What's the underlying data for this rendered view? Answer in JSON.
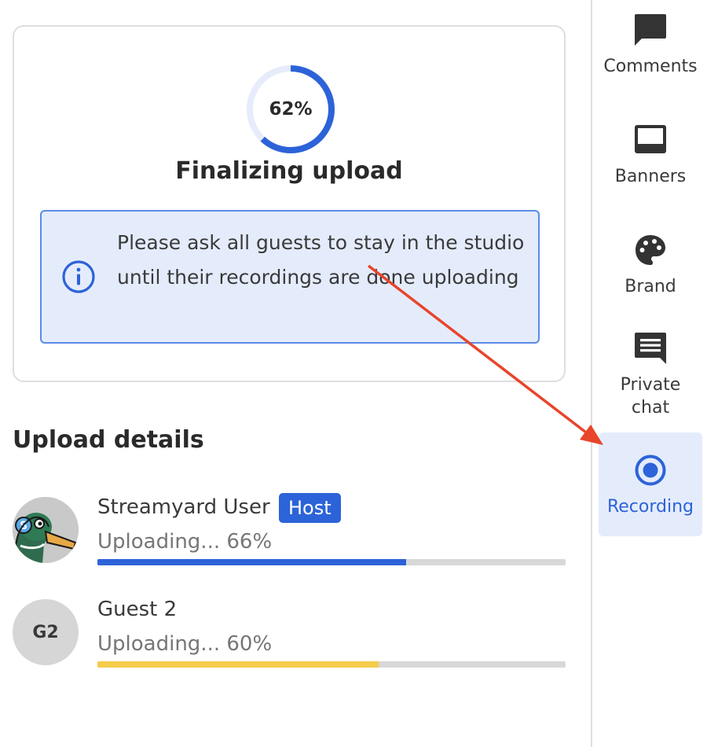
{
  "upload_card": {
    "progress_percent": 62,
    "progress_label": "62%",
    "title": "Finalizing upload",
    "notice_text": "Please ask all guests to stay in the studio until their recordings are done uploading",
    "notice_icon": "info-icon"
  },
  "upload_details": {
    "title": "Upload details",
    "participants": [
      {
        "name": "Streamyard User",
        "badge": "Host",
        "status": "Uploading... 66%",
        "progress_percent": 66,
        "bar_color": "#2d63d8",
        "avatar": "duck-avatar-icon"
      },
      {
        "name": "Guest 2",
        "initials": "G2",
        "status": "Uploading... 60%",
        "progress_percent": 60,
        "bar_color": "#f5cc4b"
      }
    ]
  },
  "sidebar": {
    "items": [
      {
        "label": "Comments",
        "icon": "comment-icon"
      },
      {
        "label": "Banners",
        "icon": "banner-icon"
      },
      {
        "label": "Brand",
        "icon": "palette-icon"
      },
      {
        "label": "Private chat",
        "icon": "chat-icon"
      },
      {
        "label": "Recording",
        "icon": "record-icon",
        "active": true
      }
    ]
  },
  "colors": {
    "accent": "#2d63d8",
    "notice_bg": "#e4ecfc",
    "annotation_arrow": "#e8452c"
  }
}
